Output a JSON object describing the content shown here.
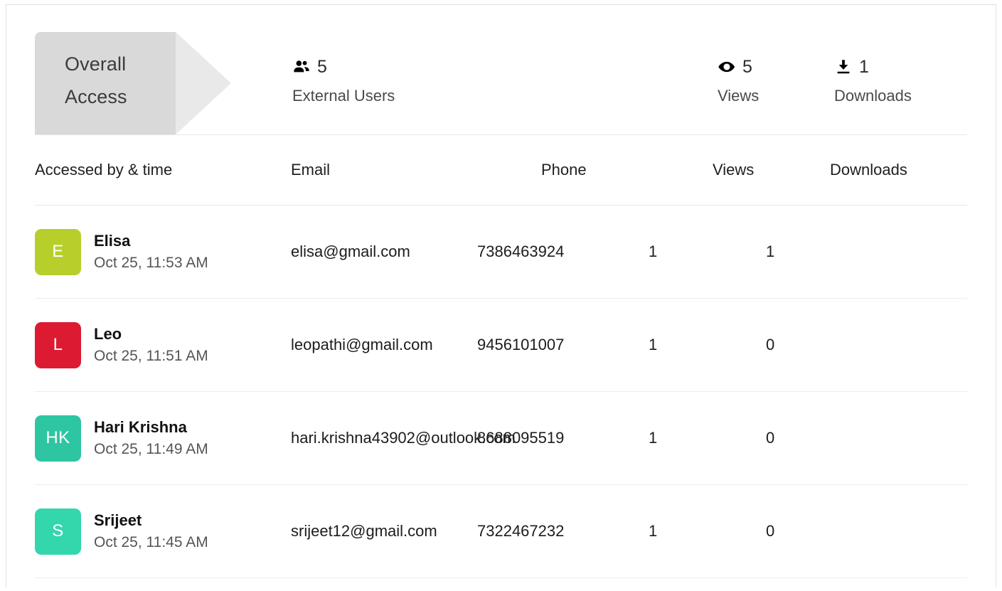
{
  "tab": {
    "label_line1": "Overall",
    "label_line2": "Access"
  },
  "stats": [
    {
      "id": "external-users",
      "icon": "users-icon",
      "value": "5",
      "label": "External Users"
    },
    {
      "id": "views",
      "icon": "eye-icon",
      "value": "5",
      "label": "Views"
    },
    {
      "id": "downloads",
      "icon": "download-icon",
      "value": "1",
      "label": "Downloads"
    }
  ],
  "table": {
    "columns": [
      "Accessed by & time",
      "Email",
      "Phone",
      "Views",
      "Downloads"
    ],
    "rows": [
      {
        "initials": "E",
        "avatar_color": "#b7ce2b",
        "name": "Elisa",
        "time": "Oct 25, 11:53 AM",
        "email": "elisa@gmail.com",
        "phone": "7386463924",
        "views": "1",
        "downloads": "1"
      },
      {
        "initials": "L",
        "avatar_color": "#dc1b33",
        "name": "Leo",
        "time": "Oct 25, 11:51 AM",
        "email": "leopathi@gmail.com",
        "phone": "9456101007",
        "views": "1",
        "downloads": "0"
      },
      {
        "initials": "HK",
        "avatar_color": "#2ec5a2",
        "name": "Hari Krishna",
        "time": "Oct 25, 11:49 AM",
        "email": "hari.krishna43902@outlook.com",
        "phone": "8688095519",
        "views": "1",
        "downloads": "0"
      },
      {
        "initials": "S",
        "avatar_color": "#34d6ab",
        "name": "Srijeet",
        "time": "Oct 25, 11:45 AM",
        "email": "srijeet12@gmail.com",
        "phone": "7322467232",
        "views": "1",
        "downloads": "0"
      }
    ]
  }
}
